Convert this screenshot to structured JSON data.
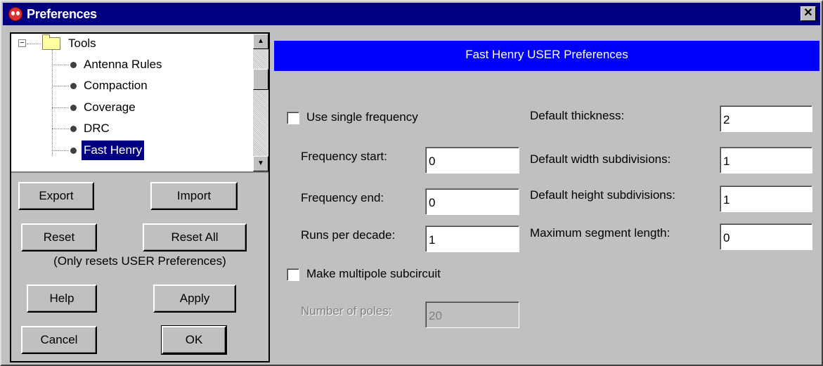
{
  "window": {
    "title": "Preferences",
    "close_glyph": "✕"
  },
  "tree": {
    "root": {
      "label": "Tools",
      "expander": "−"
    },
    "items": [
      {
        "label": "Antenna Rules"
      },
      {
        "label": "Compaction"
      },
      {
        "label": "Coverage"
      },
      {
        "label": "DRC"
      },
      {
        "label": "Fast Henry",
        "selected": true
      }
    ]
  },
  "scrollbar": {
    "up_glyph": "▲",
    "down_glyph": "▼"
  },
  "buttons": {
    "export": "Export",
    "import": "Import",
    "reset": "Reset",
    "reset_all": "Reset All",
    "reset_note": "(Only resets USER Preferences)",
    "help": "Help",
    "apply": "Apply",
    "cancel": "Cancel",
    "ok": "OK"
  },
  "panel": {
    "header": "Fast Henry USER Preferences",
    "use_single_frequency": {
      "label": "Use single frequency",
      "checked": false
    },
    "frequency_start": {
      "label": "Frequency start:",
      "value": "0"
    },
    "frequency_end": {
      "label": "Frequency end:",
      "value": "0"
    },
    "runs_per_decade": {
      "label": "Runs per decade:",
      "value": "1"
    },
    "make_multipole": {
      "label": "Make multipole subcircuit",
      "checked": false
    },
    "number_of_poles": {
      "label": "Number of poles:",
      "value": "20",
      "disabled": true
    },
    "default_thickness": {
      "label": "Default thickness:",
      "value": "2"
    },
    "default_width_subdivisions": {
      "label": "Default width subdivisions:",
      "value": "1"
    },
    "default_height_subdivisions": {
      "label": "Default height subdivisions:",
      "value": "1"
    },
    "maximum_segment_length": {
      "label": "Maximum segment length:",
      "value": "0"
    }
  },
  "colors": {
    "title_bar": "#000080",
    "panel_header": "#0000ff",
    "selection": "#000080",
    "dialog_face": "#c0c0c0"
  }
}
